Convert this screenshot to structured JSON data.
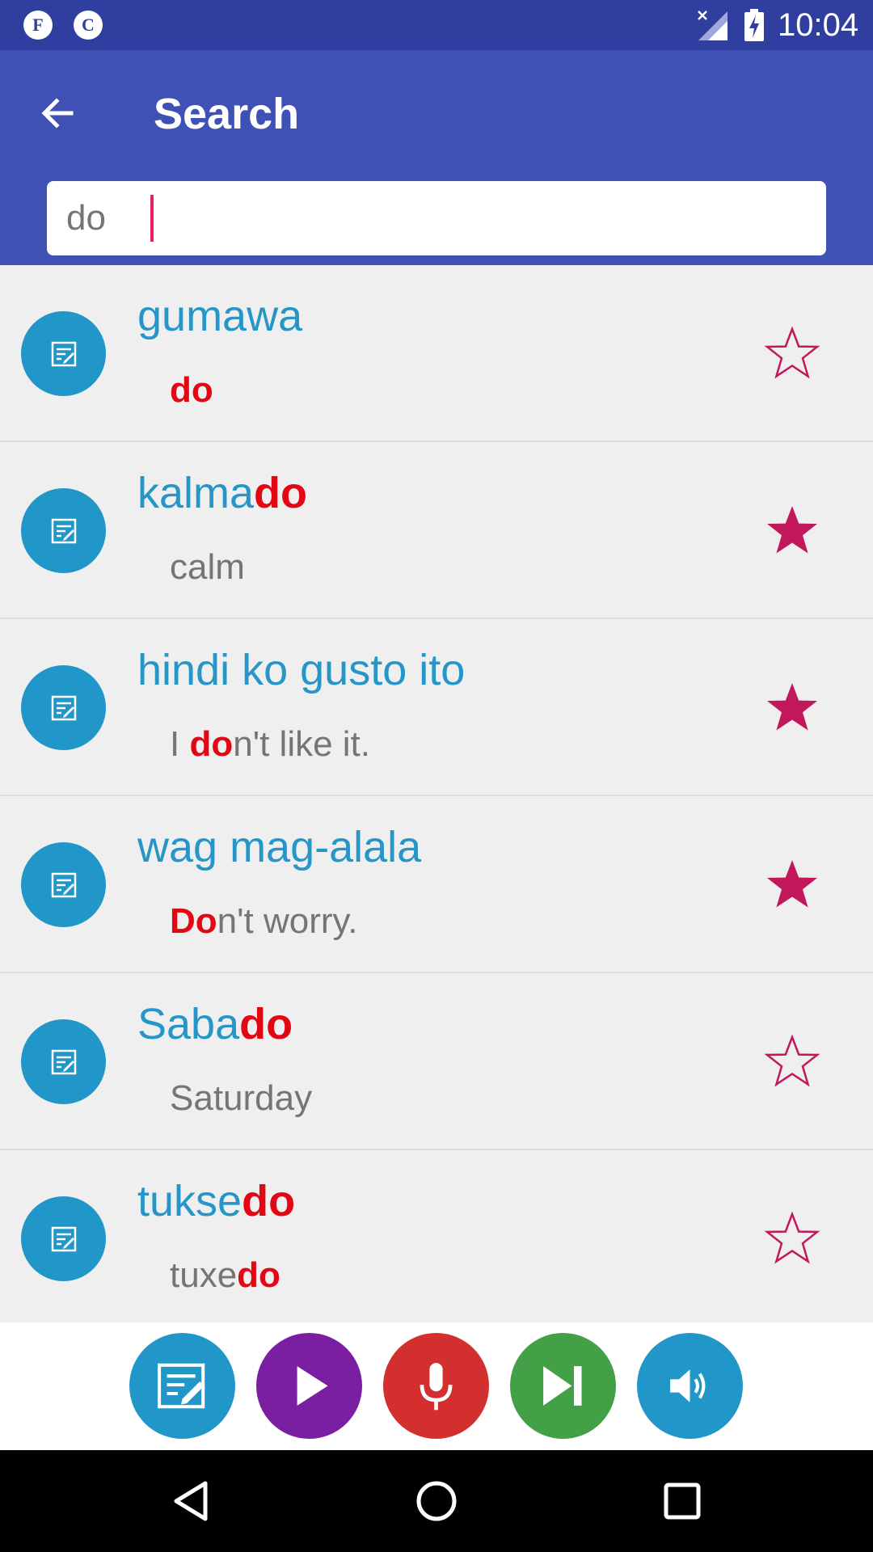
{
  "status_bar": {
    "notifications": [
      "F",
      "C"
    ],
    "time": "10:04"
  },
  "app_bar": {
    "back_icon": "arrow-left-icon",
    "title": "Search"
  },
  "search": {
    "value": "do",
    "placeholder": ""
  },
  "colors": {
    "status_bar": "#303f9f",
    "app_bar": "#3f51b5",
    "word": "#2596c7",
    "highlight": "#e30613",
    "star": "#c2185b",
    "avatar": "#2196c9"
  },
  "results": [
    {
      "word_parts": [
        {
          "t": "gumawa",
          "hl": false
        }
      ],
      "meaning_parts": [
        {
          "t": "do",
          "hl": true
        }
      ],
      "favorite": false
    },
    {
      "word_parts": [
        {
          "t": "kalma",
          "hl": false
        },
        {
          "t": "do",
          "hl": true
        }
      ],
      "meaning_parts": [
        {
          "t": "calm",
          "hl": false
        }
      ],
      "favorite": true
    },
    {
      "word_parts": [
        {
          "t": "hindi ko gusto ito",
          "hl": false
        }
      ],
      "meaning_parts": [
        {
          "t": "I ",
          "hl": false
        },
        {
          "t": "do",
          "hl": true
        },
        {
          "t": "n't like it.",
          "hl": false
        }
      ],
      "favorite": true
    },
    {
      "word_parts": [
        {
          "t": "wag mag-alala",
          "hl": false
        }
      ],
      "meaning_parts": [
        {
          "t": "Do",
          "hl": true
        },
        {
          "t": "n't worry.",
          "hl": false
        }
      ],
      "favorite": true
    },
    {
      "word_parts": [
        {
          "t": "Saba",
          "hl": false
        },
        {
          "t": "do",
          "hl": true
        }
      ],
      "meaning_parts": [
        {
          "t": "Saturday",
          "hl": false
        }
      ],
      "favorite": false
    },
    {
      "word_parts": [
        {
          "t": "tukse",
          "hl": false
        },
        {
          "t": "do",
          "hl": true
        }
      ],
      "meaning_parts": [
        {
          "t": "tuxe",
          "hl": false
        },
        {
          "t": "do",
          "hl": true
        }
      ],
      "favorite": false
    }
  ],
  "actions": [
    {
      "name": "edit-note-button",
      "icon": "edit-note-icon",
      "color": "#2196c9"
    },
    {
      "name": "play-button",
      "icon": "play-icon",
      "color": "#7b1fa2"
    },
    {
      "name": "microphone-button",
      "icon": "microphone-icon",
      "color": "#d32f2f"
    },
    {
      "name": "skip-next-button",
      "icon": "skip-next-icon",
      "color": "#43a047"
    },
    {
      "name": "volume-button",
      "icon": "volume-icon",
      "color": "#2196c9"
    }
  ],
  "nav": [
    "back-nav-icon",
    "home-nav-icon",
    "recents-nav-icon"
  ]
}
